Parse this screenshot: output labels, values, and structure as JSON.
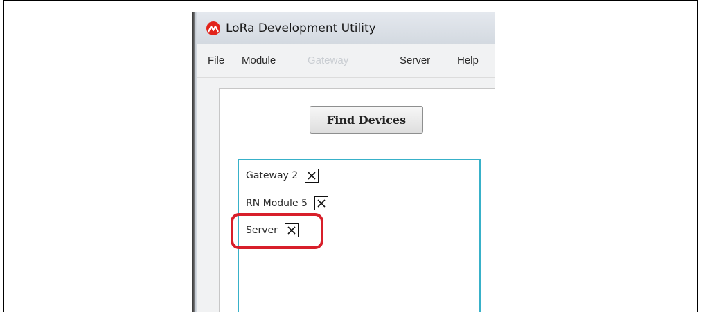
{
  "window": {
    "title": "LoRa Development Utility",
    "icon": "microchip-logo-icon"
  },
  "menu": {
    "items": [
      {
        "label": "File",
        "enabled": true
      },
      {
        "label": "Module",
        "enabled": true
      },
      {
        "label": "Gateway",
        "enabled": false
      },
      {
        "label": "Server",
        "enabled": true
      },
      {
        "label": "Help",
        "enabled": true
      }
    ]
  },
  "main": {
    "find_devices_label": "Find Devices",
    "devices": [
      {
        "label": "Gateway 2",
        "close_icon": "close-icon"
      },
      {
        "label": "RN Module 5",
        "close_icon": "close-icon"
      },
      {
        "label": "Server",
        "close_icon": "close-icon"
      }
    ]
  },
  "colors": {
    "accent_list_border": "#38b1c9",
    "highlight": "#d81f2a",
    "disabled_text": "#c9cdd2"
  }
}
